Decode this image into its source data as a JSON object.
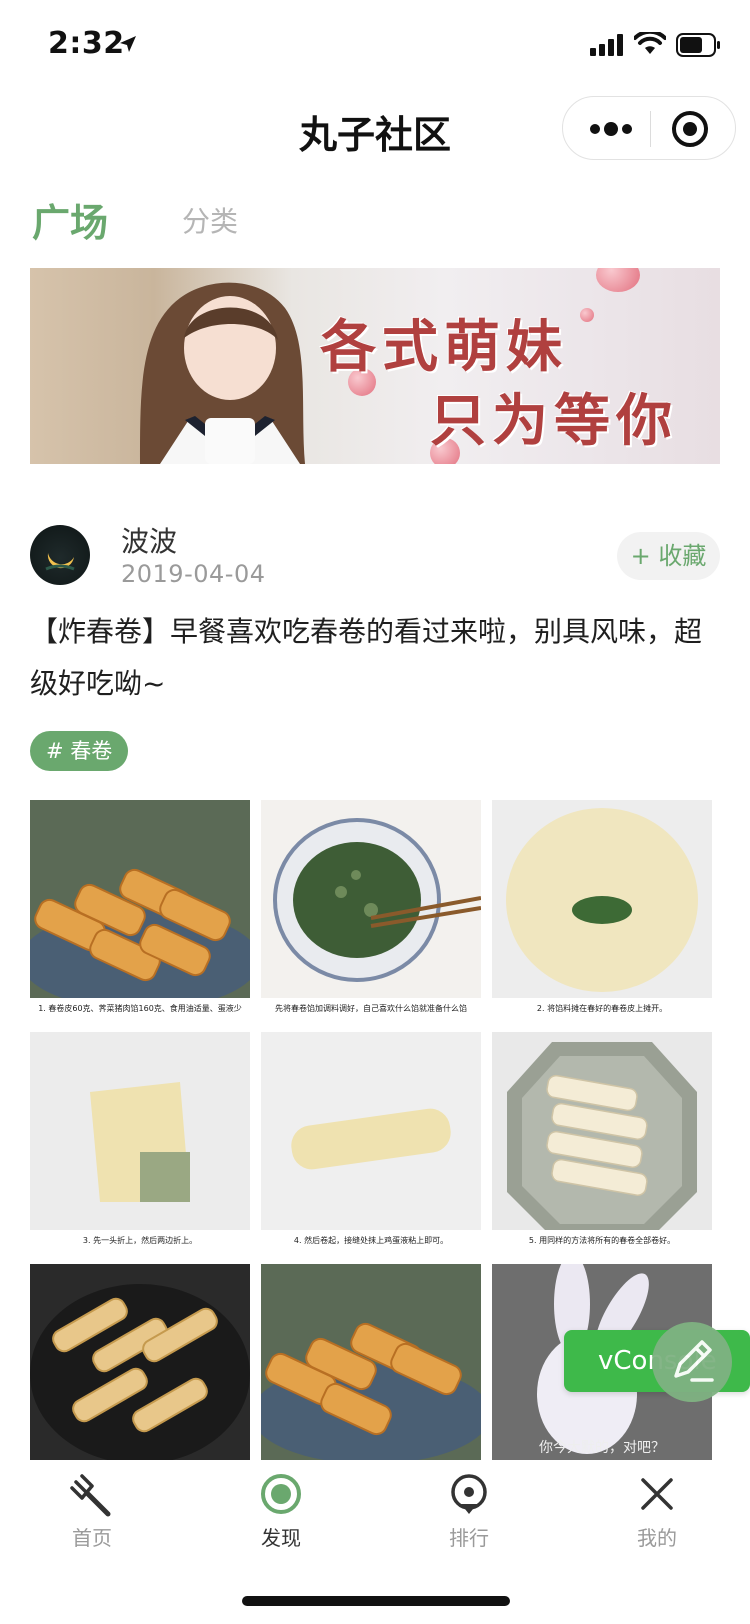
{
  "status_bar": {
    "time": "2:32"
  },
  "nav": {
    "title": "丸子社区"
  },
  "tabs": [
    {
      "label": "广场",
      "active": true
    },
    {
      "label": "分类",
      "active": false
    }
  ],
  "banner": {
    "line1": "各式萌妹",
    "line2": "只为等你"
  },
  "post": {
    "author": "波波",
    "date": "2019-04-04",
    "favorite_label": "+ 收藏",
    "text": "【炸春卷】早餐喜欢吃春卷的看过来啦，别具风味，超级好吃呦~",
    "tag": "# 春卷",
    "photos": [
      {
        "caption": "1. 春卷皮60克、荠菜猪肉馅160克、食用油适量、蛋液少"
      },
      {
        "caption": "先将春卷馅加调料调好，自己喜欢什么馅就准备什么馅"
      },
      {
        "caption": "2. 将馅料摊在春好的春卷皮上摊开。"
      },
      {
        "caption": "3. 先一头折上，然后两边折上。"
      },
      {
        "caption": "4. 然后卷起，接缝处抹上鸡蛋液粘上即可。"
      },
      {
        "caption": "5. 用同样的方法将所有的春卷全部卷好。"
      },
      {
        "caption": ""
      },
      {
        "caption": ""
      },
      {
        "caption": "你今大默的，对吧？"
      }
    ]
  },
  "vconsole": {
    "label": "vConsole"
  },
  "tabbar": [
    {
      "label": "首页",
      "icon": "fork-icon",
      "active": false
    },
    {
      "label": "发现",
      "icon": "discover-icon",
      "active": true
    },
    {
      "label": "排行",
      "icon": "location-pin-icon",
      "active": false
    },
    {
      "label": "我的",
      "icon": "close-icon",
      "active": false
    }
  ],
  "colors": {
    "accent": "#6aa86e",
    "vconsole": "#3eb94a"
  }
}
